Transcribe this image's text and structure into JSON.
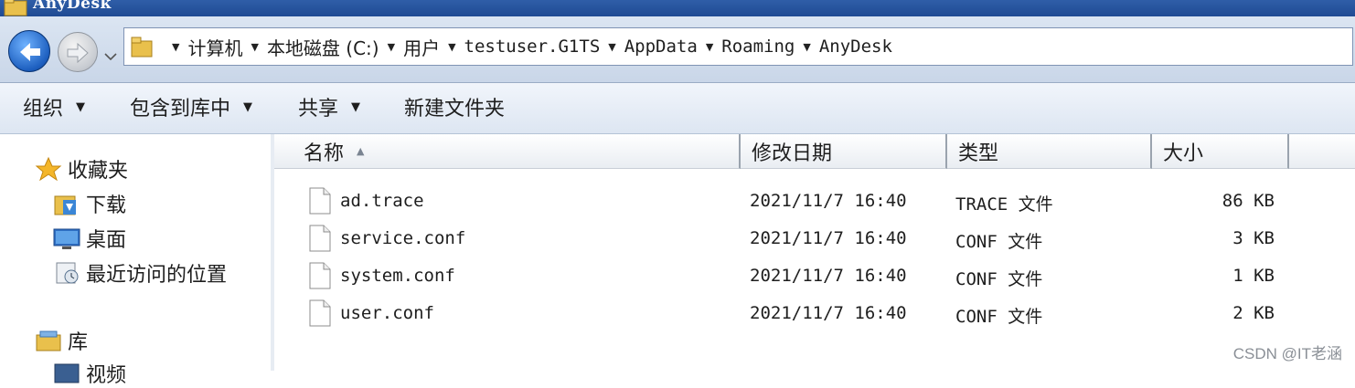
{
  "window": {
    "title": "AnyDesk"
  },
  "address": {
    "crumbs": [
      "计算机",
      "本地磁盘 (C:)",
      "用户",
      "testuser.G1TS",
      "AppData",
      "Roaming",
      "AnyDesk"
    ]
  },
  "toolbar": {
    "organize": "组织",
    "include_in_library": "包含到库中",
    "share": "共享",
    "new_folder": "新建文件夹"
  },
  "navpane": {
    "favorites": "收藏夹",
    "downloads": "下载",
    "desktop": "桌面",
    "recent": "最近访问的位置",
    "libraries": "库",
    "videos": "视频"
  },
  "columns": {
    "name": "名称",
    "modified": "修改日期",
    "type": "类型",
    "size": "大小"
  },
  "files": [
    {
      "name": "ad.trace",
      "modified": "2021/11/7 16:40",
      "type": "TRACE 文件",
      "size": "86 KB"
    },
    {
      "name": "service.conf",
      "modified": "2021/11/7 16:40",
      "type": "CONF 文件",
      "size": "3 KB"
    },
    {
      "name": "system.conf",
      "modified": "2021/11/7 16:40",
      "type": "CONF 文件",
      "size": "1 KB"
    },
    {
      "name": "user.conf",
      "modified": "2021/11/7 16:40",
      "type": "CONF 文件",
      "size": "2 KB"
    }
  ],
  "watermark": "CSDN @IT老涵",
  "colors": {
    "accent": "#1d5fbf",
    "titlebar": "#2f5ea8",
    "toolbar": "#dde6f2"
  }
}
